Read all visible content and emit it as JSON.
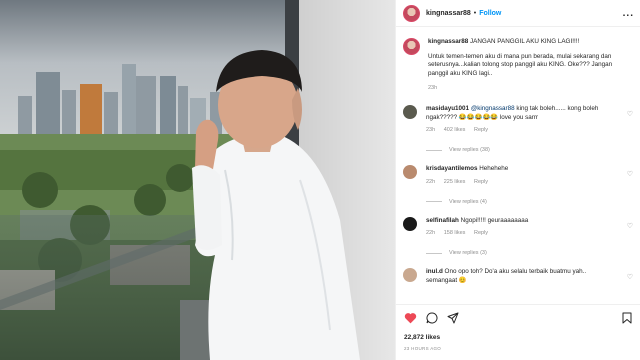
{
  "post": {
    "username": "kingnassar88",
    "follow_label": "Follow",
    "dot": "•",
    "more_label": "...",
    "caption": {
      "username": "kingnassar88",
      "headline": "JANGAN PANGGIL AKU KING LAGI!!!!",
      "body": "Untuk temen-temen aku di mana pun berada, mulai sekarang dan seterusnya...kalian tolong stop panggil aku KING. Oke??? Jangan panggil aku KING lagi..",
      "time": "23h"
    },
    "likes": "22,872 likes",
    "posted_ago": "23 HOURS AGO"
  },
  "comments": [
    {
      "username": "masidayu1001",
      "mention": "@kingnassar88",
      "text": "king tak boleh...... kong boleh ngak?????",
      "emoji": "😂😂😂😂😂",
      "tail": "love you sarrr",
      "time": "23h",
      "likes": "402 likes",
      "reply": "Reply",
      "view_replies": "View replies (38)",
      "color": "#5a5a4e"
    },
    {
      "username": "krisdayantilemos",
      "mention": "",
      "text": "Hehehehe",
      "emoji": "",
      "tail": "",
      "time": "22h",
      "likes": "225 likes",
      "reply": "Reply",
      "view_replies": "View replies (4)",
      "color": "#b98a6e"
    },
    {
      "username": "selfinafilah",
      "mention": "",
      "text": "Ngopi!!!!! geuraaaaaaaa",
      "emoji": "",
      "tail": "",
      "time": "22h",
      "likes": "158 likes",
      "reply": "Reply",
      "view_replies": "View replies (3)",
      "color": "#1a1a1a"
    },
    {
      "username": "inul.d",
      "mention": "",
      "text": "Ono opo toh? Do'a aku selalu terbaik buatmu yah.. semangaat",
      "emoji": "😊",
      "tail": "",
      "time": "",
      "likes": "",
      "reply": "",
      "view_replies": "",
      "color": "#c9a88f"
    }
  ],
  "icons": {
    "like": "heart-icon",
    "comment": "comment-icon",
    "share": "share-icon",
    "save": "bookmark-icon"
  },
  "colors": {
    "accent": "#0095f6",
    "like_red": "#ed4956",
    "muted": "#8e8e8e"
  }
}
